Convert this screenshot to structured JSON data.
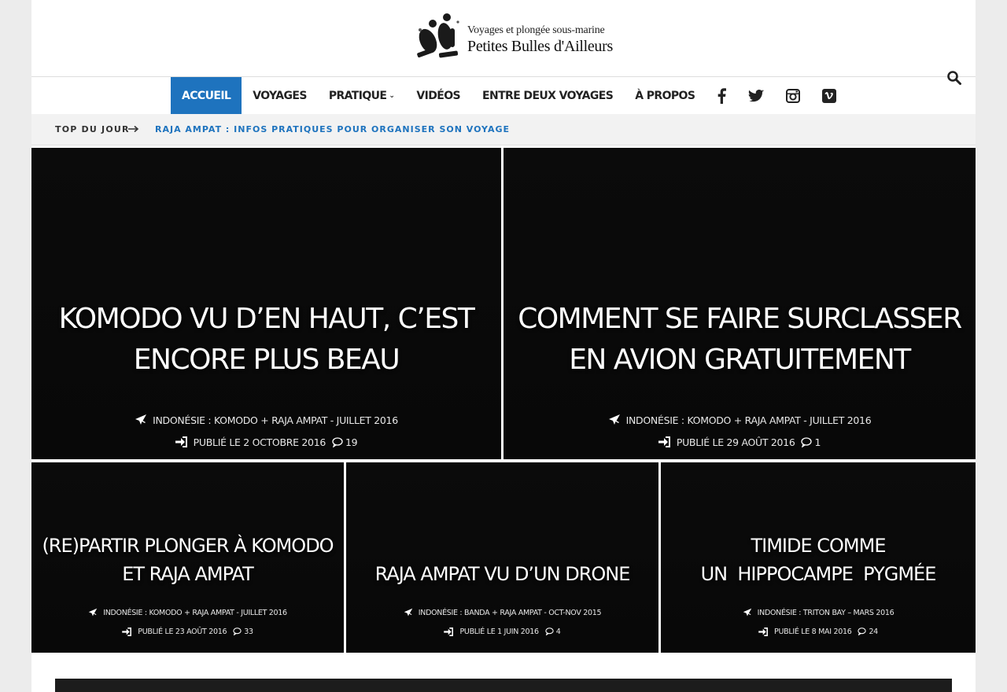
{
  "logo": {
    "line1": "Voyages et plongée sous-marine",
    "line2": "Petites Bulles d'Ailleurs"
  },
  "nav": {
    "items": [
      {
        "label": "ACCUEIL"
      },
      {
        "label": "VOYAGES"
      },
      {
        "label": "PRATIQUE"
      },
      {
        "label": "VIDÉOS"
      },
      {
        "label": "ENTRE DEUX VOYAGES"
      },
      {
        "label": "À PROPOS"
      }
    ],
    "social": [
      "facebook-icon",
      "twitter-icon",
      "instagram-icon",
      "vimeo-icon"
    ],
    "search_icon": "search-icon",
    "accent_color": "#1e73be"
  },
  "ticker": {
    "label": "TOP DU JOUR",
    "link": "RAJA AMPAT : INFOS PRATIQUES POUR ORGANISER SON VOYAGE"
  },
  "featured": [
    {
      "title_line1": "KOMODO VU D’EN HAUT, C’EST",
      "title_line2": "ENCORE PLUS BEAU",
      "category": "INDONÉSIE : KOMODO + RAJA AMPAT - JUILLET 2016",
      "date": "PUBLIÉ LE 2 OCTOBRE 2016",
      "comments": "19"
    },
    {
      "title_line1": "COMMENT SE FAIRE SURCLASSER",
      "title_line2": "EN AVION GRATUITEMENT",
      "category": "INDONÉSIE : KOMODO + RAJA AMPAT - JUILLET 2016",
      "date": "PUBLIÉ LE 29 AOÛT 2016",
      "comments": "1"
    },
    {
      "title_line1": "(RE)PARTIR PLONGER À KOMODO",
      "title_line2": "ET RAJA AMPAT",
      "category": "INDONÉSIE : KOMODO + RAJA AMPAT - JUILLET 2016",
      "date": "PUBLIÉ LE 23 AOÛT 2016",
      "comments": "33"
    },
    {
      "title_line1": "RAJA AMPAT VU D’UN DRONE",
      "title_line2": "",
      "category": "INDONÉSIE : BANDA + RAJA AMPAT - OCT-NOV 2015",
      "date": "PUBLIÉ LE 1 JUIN 2016",
      "comments": "4"
    },
    {
      "title_line1": "TIMIDE COMME",
      "title_line2": "UN  HIPPOCAMPE  PYGMÉE",
      "category": "INDONÉSIE : TRITON BAY – MARS 2016",
      "date": "PUBLIÉ LE 8 MAI 2016",
      "comments": "24"
    }
  ]
}
